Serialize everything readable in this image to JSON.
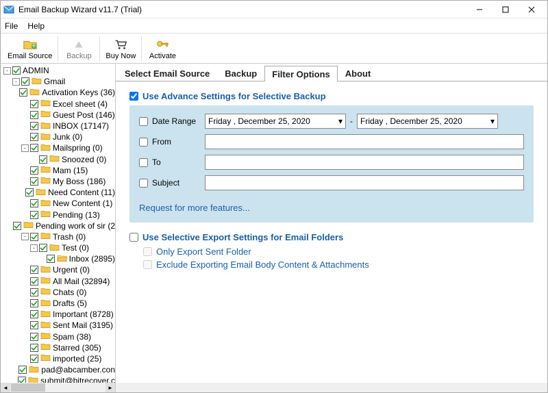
{
  "window": {
    "title": "Email Backup Wizard v11.7 (Trial)"
  },
  "menu": {
    "file": "File",
    "help": "Help"
  },
  "toolbar": {
    "email_source": "Email Source",
    "backup": "Backup",
    "buy_now": "Buy Now",
    "activate": "Activate"
  },
  "tree": [
    {
      "indent": 0,
      "exp": "-",
      "chk": true,
      "icon": "none",
      "label": "ADMIN"
    },
    {
      "indent": 1,
      "exp": "-",
      "chk": true,
      "icon": "folder",
      "label": "Gmail"
    },
    {
      "indent": 2,
      "exp": "",
      "chk": true,
      "icon": "folder",
      "label": "Activation Keys (36)"
    },
    {
      "indent": 2,
      "exp": "",
      "chk": true,
      "icon": "folder",
      "label": "Excel sheet (4)"
    },
    {
      "indent": 2,
      "exp": "",
      "chk": true,
      "icon": "folder",
      "label": "Guest Post (146)"
    },
    {
      "indent": 2,
      "exp": "",
      "chk": true,
      "icon": "folder",
      "label": "INBOX (17147)"
    },
    {
      "indent": 2,
      "exp": "",
      "chk": true,
      "icon": "folder",
      "label": "Junk (0)"
    },
    {
      "indent": 2,
      "exp": "-",
      "chk": true,
      "icon": "folder",
      "label": "Mailspring (0)"
    },
    {
      "indent": 3,
      "exp": "",
      "chk": true,
      "icon": "folder",
      "label": "Snoozed (0)"
    },
    {
      "indent": 2,
      "exp": "",
      "chk": true,
      "icon": "folder",
      "label": "Mam (15)"
    },
    {
      "indent": 2,
      "exp": "",
      "chk": true,
      "icon": "folder",
      "label": "My Boss (186)"
    },
    {
      "indent": 2,
      "exp": "",
      "chk": true,
      "icon": "folder",
      "label": "Need Content (11)"
    },
    {
      "indent": 2,
      "exp": "",
      "chk": true,
      "icon": "folder",
      "label": "New Content (1)"
    },
    {
      "indent": 2,
      "exp": "",
      "chk": true,
      "icon": "folder",
      "label": "Pending (13)"
    },
    {
      "indent": 2,
      "exp": "",
      "chk": true,
      "icon": "folder",
      "label": "Pending work of sir (2"
    },
    {
      "indent": 2,
      "exp": "-",
      "chk": true,
      "icon": "folder",
      "label": "Trash (0)"
    },
    {
      "indent": 3,
      "exp": "-",
      "chk": true,
      "icon": "folder",
      "label": "Test (0)"
    },
    {
      "indent": 4,
      "exp": "",
      "chk": true,
      "icon": "folder-open",
      "label": "Inbox (2895)"
    },
    {
      "indent": 2,
      "exp": "",
      "chk": true,
      "icon": "folder",
      "label": "Urgent (0)"
    },
    {
      "indent": 2,
      "exp": "",
      "chk": true,
      "icon": "folder",
      "label": "All Mail (32894)"
    },
    {
      "indent": 2,
      "exp": "",
      "chk": true,
      "icon": "folder",
      "label": "Chats (0)"
    },
    {
      "indent": 2,
      "exp": "",
      "chk": true,
      "icon": "folder",
      "label": "Drafts (5)"
    },
    {
      "indent": 2,
      "exp": "",
      "chk": true,
      "icon": "folder",
      "label": "Important (8728)"
    },
    {
      "indent": 2,
      "exp": "",
      "chk": true,
      "icon": "folder",
      "label": "Sent Mail (3195)"
    },
    {
      "indent": 2,
      "exp": "",
      "chk": true,
      "icon": "folder",
      "label": "Spam (38)"
    },
    {
      "indent": 2,
      "exp": "",
      "chk": true,
      "icon": "folder",
      "label": "Starred (305)"
    },
    {
      "indent": 2,
      "exp": "",
      "chk": true,
      "icon": "folder",
      "label": "imported (25)"
    },
    {
      "indent": 2,
      "exp": "",
      "chk": true,
      "icon": "folder",
      "label": "pad@abcamber.con"
    },
    {
      "indent": 2,
      "exp": "",
      "chk": true,
      "icon": "folder",
      "label": "submit@bitrecover.c"
    }
  ],
  "tabs": {
    "select_source": "Select Email Source",
    "backup": "Backup",
    "filter": "Filter Options",
    "about": "About",
    "active": "filter"
  },
  "filter": {
    "advance_label": "Use Advance Settings for Selective Backup",
    "advance_checked": true,
    "date_range": "Date Range",
    "date_from": "Friday   ,  December  25,  2020",
    "date_to": "Friday   ,  December  25,  2020",
    "from": "From",
    "to": "To",
    "subject": "Subject",
    "request": "Request for more features...",
    "selective_label": "Use Selective Export Settings for Email Folders",
    "selective_checked": false,
    "only_sent": "Only Export Sent Folder",
    "exclude_body": "Exclude Exporting Email Body Content & Attachments"
  }
}
